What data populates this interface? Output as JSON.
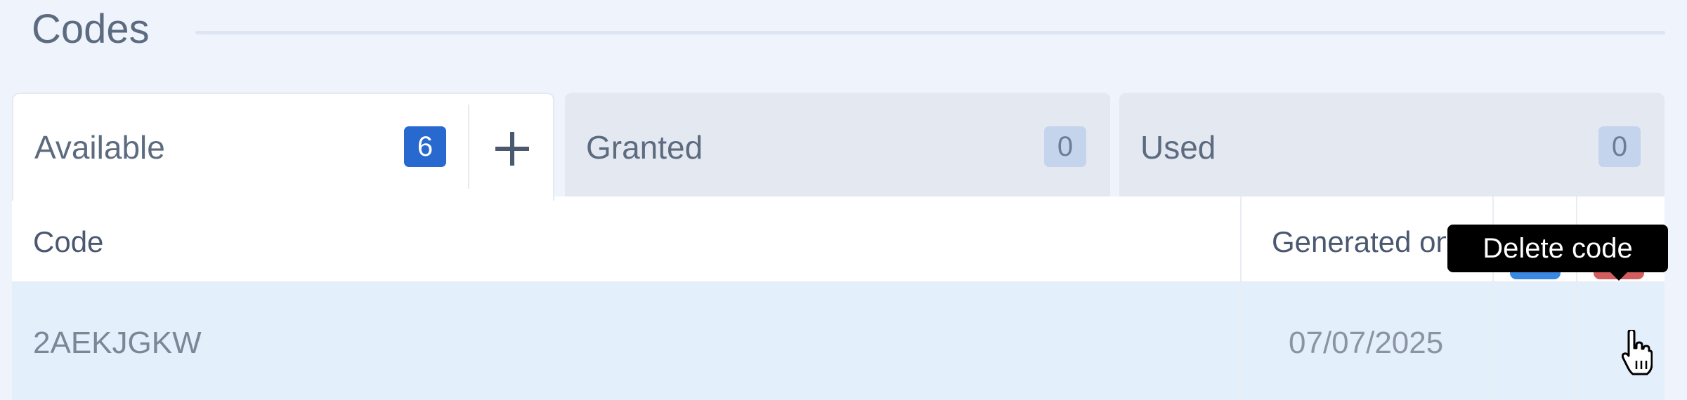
{
  "section": {
    "title": "Codes"
  },
  "tabs": [
    {
      "label": "Available",
      "count": "6"
    },
    {
      "label": "Granted",
      "count": "0"
    },
    {
      "label": "Used",
      "count": "0"
    }
  ],
  "add_icon": "plus-icon",
  "table": {
    "columns": [
      "Code",
      "Generated on"
    ],
    "rows": [
      {
        "code": "2AEKJGKW",
        "generated_on": "07/07/2025"
      }
    ]
  },
  "actions": {
    "grant_icon": "hand-package-icon",
    "delete_icon": "trash-icon"
  },
  "tooltip": {
    "text": "Delete code"
  },
  "colors": {
    "active_badge": "#2869d0",
    "inactive_badge": "#c4d4ec",
    "grant_button": "#3a88e2",
    "delete_button": "#d25e5e",
    "selected_row": "#e4effc"
  }
}
